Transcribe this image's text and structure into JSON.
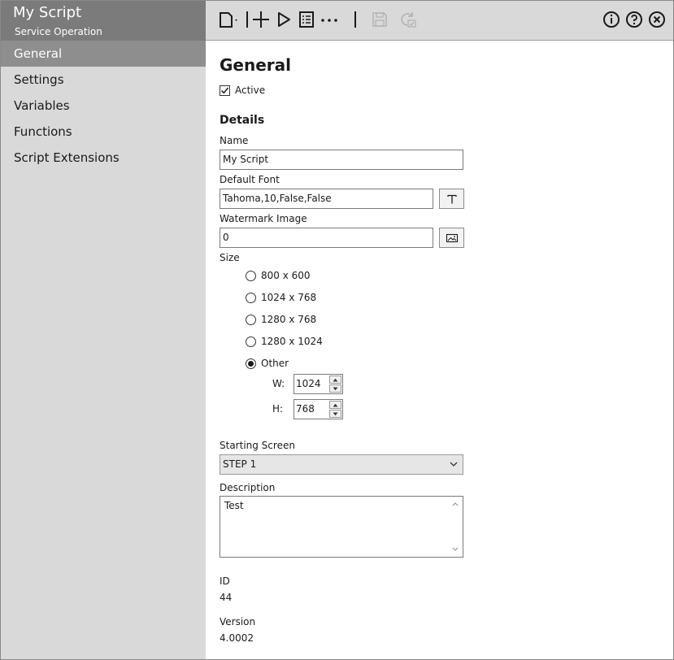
{
  "window": {
    "title": "My Script",
    "subtitle": "Service Operation"
  },
  "toolbar": {
    "icons": [
      "new-document-icon",
      "add-icon",
      "play-icon",
      "list-icon",
      "more-icon",
      "save-icon",
      "refresh-check-icon",
      "info-icon",
      "help-icon",
      "close-icon"
    ]
  },
  "sidebar": {
    "items": [
      {
        "label": "General",
        "active": true
      },
      {
        "label": "Settings",
        "active": false
      },
      {
        "label": "Variables",
        "active": false
      },
      {
        "label": "Functions",
        "active": false
      },
      {
        "label": "Script Extensions",
        "active": false
      }
    ]
  },
  "general": {
    "heading": "General",
    "active_label": "Active",
    "active_checked": true,
    "details_heading": "Details",
    "name_label": "Name",
    "name_value": "My Script",
    "font_label": "Default Font",
    "font_value": "Tahoma,10,False,False",
    "watermark_label": "Watermark Image",
    "watermark_value": "0",
    "size_label": "Size",
    "size_options": [
      {
        "label": "800 x 600",
        "selected": false
      },
      {
        "label": "1024 x 768",
        "selected": false
      },
      {
        "label": "1280 x 768",
        "selected": false
      },
      {
        "label": "1280 x 1024",
        "selected": false
      },
      {
        "label": "Other",
        "selected": true
      }
    ],
    "width_label": "W:",
    "width_value": "1024",
    "height_label": "H:",
    "height_value": "768",
    "starting_screen_label": "Starting Screen",
    "starting_screen_value": "STEP 1",
    "description_label": "Description",
    "description_value": "Test",
    "id_label": "ID",
    "id_value": "44",
    "version_label": "Version",
    "version_value": "4.0002"
  },
  "colors": {
    "title_bg": "#7b7b7b",
    "toolbar_bg": "#d9d9d9",
    "sidebar_bg": "#d9d9d9",
    "sidebar_active_bg": "#8e8e8e"
  }
}
